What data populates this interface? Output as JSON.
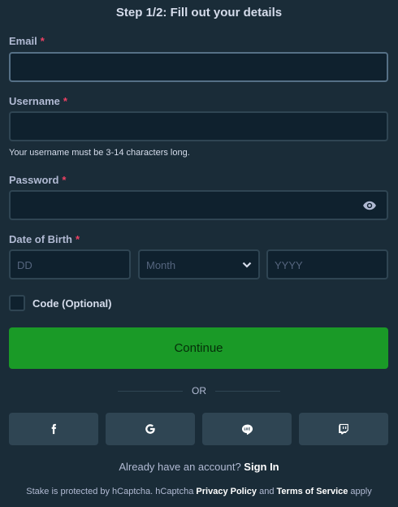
{
  "header": {
    "title": "Step 1/2: Fill out your details"
  },
  "form": {
    "email": {
      "label": "Email",
      "required": "*",
      "value": ""
    },
    "username": {
      "label": "Username",
      "required": "*",
      "value": "",
      "hint": "Your username must be 3-14 characters long."
    },
    "password": {
      "label": "Password",
      "required": "*",
      "value": ""
    },
    "dob": {
      "label": "Date of Birth",
      "required": "*",
      "day_placeholder": "DD",
      "month_selected": "Month",
      "year_placeholder": "YYYY"
    },
    "code": {
      "label": "Code (Optional)",
      "checked": false
    },
    "continue_label": "Continue"
  },
  "divider": {
    "text": "OR"
  },
  "social": [
    {
      "name": "facebook-icon"
    },
    {
      "name": "google-icon"
    },
    {
      "name": "line-icon"
    },
    {
      "name": "twitch-icon"
    }
  ],
  "footer": {
    "have_account": "Already have an account?",
    "sign_in": "Sign In",
    "legal_prefix": "Stake is protected by hCaptcha. hCaptcha",
    "privacy": "Privacy Policy",
    "and": "and",
    "terms": "Terms of Service",
    "apply": "apply"
  },
  "colors": {
    "background": "#1a2c38",
    "input_bg": "#0f212e",
    "border": "#2f4553",
    "accent_green": "#1a9a27",
    "required": "#ed4163"
  }
}
